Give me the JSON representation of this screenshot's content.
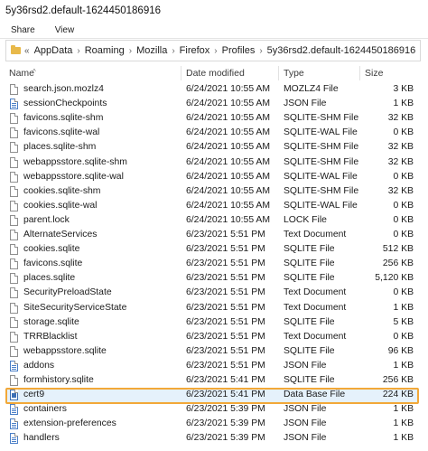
{
  "window": {
    "title": "5y36rsd2.default-1624450186916"
  },
  "ribbon": {
    "share": "Share",
    "view": "View"
  },
  "breadcrumb": {
    "chevrons": "«",
    "items": [
      "AppData",
      "Roaming",
      "Mozilla",
      "Firefox",
      "Profiles",
      "5y36rsd2.default-1624450186916"
    ],
    "separator": "›"
  },
  "columns": {
    "name": "Name",
    "date": "Date modified",
    "type": "Type",
    "size": "Size"
  },
  "files": [
    {
      "name": "search.json.mozlz4",
      "date": "6/24/2021 10:55 AM",
      "type": "MOZLZ4 File",
      "size": "3 KB",
      "icon": "file-icon"
    },
    {
      "name": "sessionCheckpoints",
      "date": "6/24/2021 10:55 AM",
      "type": "JSON File",
      "size": "1 KB",
      "icon": "json-file-icon"
    },
    {
      "name": "favicons.sqlite-shm",
      "date": "6/24/2021 10:55 AM",
      "type": "SQLITE-SHM File",
      "size": "32 KB",
      "icon": "file-icon"
    },
    {
      "name": "favicons.sqlite-wal",
      "date": "6/24/2021 10:55 AM",
      "type": "SQLITE-WAL File",
      "size": "0 KB",
      "icon": "file-icon"
    },
    {
      "name": "places.sqlite-shm",
      "date": "6/24/2021 10:55 AM",
      "type": "SQLITE-SHM File",
      "size": "32 KB",
      "icon": "file-icon"
    },
    {
      "name": "webappsstore.sqlite-shm",
      "date": "6/24/2021 10:55 AM",
      "type": "SQLITE-SHM File",
      "size": "32 KB",
      "icon": "file-icon"
    },
    {
      "name": "webappsstore.sqlite-wal",
      "date": "6/24/2021 10:55 AM",
      "type": "SQLITE-WAL File",
      "size": "0 KB",
      "icon": "file-icon"
    },
    {
      "name": "cookies.sqlite-shm",
      "date": "6/24/2021 10:55 AM",
      "type": "SQLITE-SHM File",
      "size": "32 KB",
      "icon": "file-icon"
    },
    {
      "name": "cookies.sqlite-wal",
      "date": "6/24/2021 10:55 AM",
      "type": "SQLITE-WAL File",
      "size": "0 KB",
      "icon": "file-icon"
    },
    {
      "name": "parent.lock",
      "date": "6/24/2021 10:55 AM",
      "type": "LOCK File",
      "size": "0 KB",
      "icon": "file-icon"
    },
    {
      "name": "AlternateServices",
      "date": "6/23/2021 5:51 PM",
      "type": "Text Document",
      "size": "0 KB",
      "icon": "file-icon"
    },
    {
      "name": "cookies.sqlite",
      "date": "6/23/2021 5:51 PM",
      "type": "SQLITE File",
      "size": "512 KB",
      "icon": "file-icon"
    },
    {
      "name": "favicons.sqlite",
      "date": "6/23/2021 5:51 PM",
      "type": "SQLITE File",
      "size": "256 KB",
      "icon": "file-icon"
    },
    {
      "name": "places.sqlite",
      "date": "6/23/2021 5:51 PM",
      "type": "SQLITE File",
      "size": "5,120 KB",
      "icon": "file-icon"
    },
    {
      "name": "SecurityPreloadState",
      "date": "6/23/2021 5:51 PM",
      "type": "Text Document",
      "size": "0 KB",
      "icon": "file-icon"
    },
    {
      "name": "SiteSecurityServiceState",
      "date": "6/23/2021 5:51 PM",
      "type": "Text Document",
      "size": "1 KB",
      "icon": "file-icon"
    },
    {
      "name": "storage.sqlite",
      "date": "6/23/2021 5:51 PM",
      "type": "SQLITE File",
      "size": "5 KB",
      "icon": "file-icon"
    },
    {
      "name": "TRRBlacklist",
      "date": "6/23/2021 5:51 PM",
      "type": "Text Document",
      "size": "0 KB",
      "icon": "file-icon"
    },
    {
      "name": "webappsstore.sqlite",
      "date": "6/23/2021 5:51 PM",
      "type": "SQLITE File",
      "size": "96 KB",
      "icon": "file-icon"
    },
    {
      "name": "addons",
      "date": "6/23/2021 5:51 PM",
      "type": "JSON File",
      "size": "1 KB",
      "icon": "json-file-icon"
    },
    {
      "name": "formhistory.sqlite",
      "date": "6/23/2021 5:41 PM",
      "type": "SQLITE File",
      "size": "256 KB",
      "icon": "file-icon"
    },
    {
      "name": "cert9",
      "date": "6/23/2021 5:41 PM",
      "type": "Data Base File",
      "size": "224 KB",
      "icon": "database-file-icon",
      "selected": true
    },
    {
      "name": "containers",
      "date": "6/23/2021 5:39 PM",
      "type": "JSON File",
      "size": "1 KB",
      "icon": "json-file-icon"
    },
    {
      "name": "extension-preferences",
      "date": "6/23/2021 5:39 PM",
      "type": "JSON File",
      "size": "1 KB",
      "icon": "json-file-icon"
    },
    {
      "name": "handlers",
      "date": "6/23/2021 5:39 PM",
      "type": "JSON File",
      "size": "1 KB",
      "icon": "json-file-icon"
    }
  ],
  "colors": {
    "highlight": "#f2a838",
    "selection": "#e5f1fb",
    "folder": "#e8b94a"
  }
}
